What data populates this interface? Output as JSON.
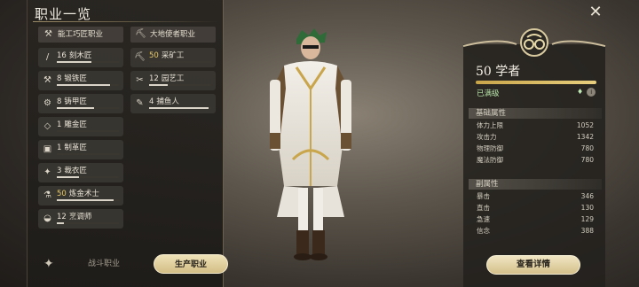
{
  "panel": {
    "title": "职业一览"
  },
  "categories": [
    {
      "label": "能工巧匠职业",
      "icon": "hammer-icon",
      "glyph": "⚒"
    },
    {
      "label": "大地使者职业",
      "icon": "pickaxe-icon",
      "glyph": "⛏"
    }
  ],
  "jobs": [
    {
      "level": "16",
      "name": "刻木匠",
      "icon": "saw-icon",
      "glyph": "/",
      "progress": 0.55,
      "max": false
    },
    {
      "level": "50",
      "name": "采矿工",
      "icon": "pickaxe-icon",
      "glyph": "⛏",
      "progress": 0.0,
      "max": true
    },
    {
      "level": "8",
      "name": "锻铁匠",
      "icon": "anvil-icon",
      "glyph": "⚒",
      "progress": 0.85,
      "max": false
    },
    {
      "level": "12",
      "name": "园艺工",
      "icon": "sickle-icon",
      "glyph": "✂",
      "progress": 0.3,
      "max": false
    },
    {
      "level": "8",
      "name": "铸甲匠",
      "icon": "hammer-icon",
      "glyph": "⚙",
      "progress": 0.6,
      "max": false
    },
    {
      "level": "4",
      "name": "捕鱼人",
      "icon": "fishing-rod-icon",
      "glyph": "✎",
      "progress": 0.95,
      "max": false
    },
    {
      "level": "1",
      "name": "雕金匠",
      "icon": "gem-icon",
      "glyph": "◇",
      "progress": 0.0,
      "max": false
    },
    {
      "level": "1",
      "name": "制革匠",
      "icon": "leather-icon",
      "glyph": "▣",
      "progress": 0.0,
      "max": false
    },
    {
      "level": "3",
      "name": "裁衣匠",
      "icon": "needle-icon",
      "glyph": "✦",
      "progress": 0.35,
      "max": false
    },
    {
      "level": "50",
      "name": "炼金术士",
      "icon": "flask-icon",
      "glyph": "⚗",
      "progress": 0.92,
      "max": true
    },
    {
      "level": "12",
      "name": "烹调师",
      "icon": "pot-icon",
      "glyph": "◒",
      "progress": 0.12,
      "max": false
    }
  ],
  "tabs": {
    "combat": "战斗职业",
    "crafting": "生产职业"
  },
  "current_job": {
    "level": "50",
    "name": "学者",
    "status": "已满级",
    "exp_progress": 1.0
  },
  "base_stats": {
    "header": "基础属性",
    "items": [
      {
        "name": "体力上限",
        "value": "1052"
      },
      {
        "name": "攻击力",
        "value": "1342"
      },
      {
        "name": "物理防御",
        "value": "780"
      },
      {
        "name": "魔法防御",
        "value": "780"
      }
    ]
  },
  "sub_stats": {
    "header": "副属性",
    "items": [
      {
        "name": "暴击",
        "value": "346"
      },
      {
        "name": "直击",
        "value": "130"
      },
      {
        "name": "急速",
        "value": "129"
      },
      {
        "name": "信念",
        "value": "388"
      }
    ]
  },
  "detail_button": "查看详情",
  "colors": {
    "accent_gold": "#d9c48f",
    "max_level": "#e6c86a",
    "status_green": "#b7e3a8"
  }
}
